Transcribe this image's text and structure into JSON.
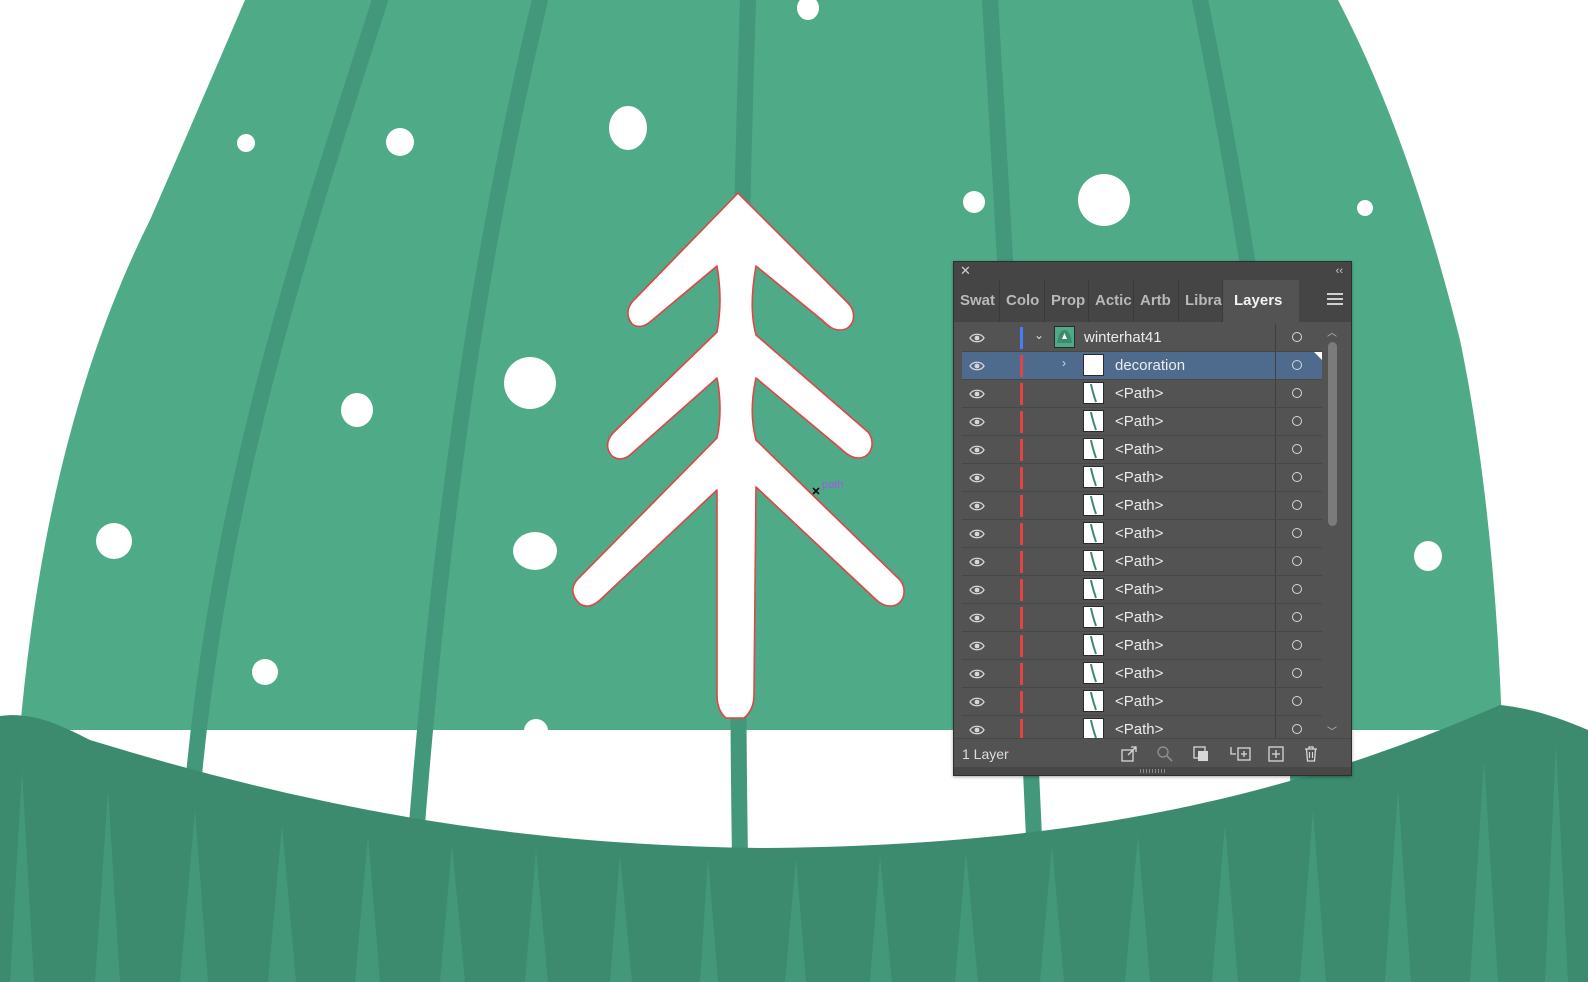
{
  "canvas": {
    "anchor_label": "path",
    "colors": {
      "hat_main": "#4faa88",
      "hat_stripes": "#43977a",
      "hat_cuff": "#3c8b6f",
      "cuff_ribs": "#44987a",
      "snow": "#ffffff",
      "tree_outline": "#e04040"
    }
  },
  "layers_panel": {
    "close_icon": "✕",
    "collapse_icon": "‹‹",
    "tabs": [
      {
        "label": "Swat"
      },
      {
        "label": "Colo"
      },
      {
        "label": "Prop"
      },
      {
        "label": "Actic"
      },
      {
        "label": "Artb"
      },
      {
        "label": "Libra"
      },
      {
        "label": "Layers",
        "active": true
      }
    ],
    "rows": [
      {
        "name": "winterhat41",
        "twisty": "⌄",
        "color": "#4a7bff",
        "thumb": "hat"
      },
      {
        "name": "decoration",
        "twisty": "›",
        "color": "#e04545",
        "thumb": "blank",
        "selected": true
      },
      {
        "name": "<Path>",
        "color": "#e04545",
        "thumb": "path"
      },
      {
        "name": "<Path>",
        "color": "#e04545",
        "thumb": "path"
      },
      {
        "name": "<Path>",
        "color": "#e04545",
        "thumb": "path"
      },
      {
        "name": "<Path>",
        "color": "#e04545",
        "thumb": "path"
      },
      {
        "name": "<Path>",
        "color": "#e04545",
        "thumb": "path"
      },
      {
        "name": "<Path>",
        "color": "#e04545",
        "thumb": "path"
      },
      {
        "name": "<Path>",
        "color": "#e04545",
        "thumb": "path"
      },
      {
        "name": "<Path>",
        "color": "#e04545",
        "thumb": "path"
      },
      {
        "name": "<Path>",
        "color": "#e04545",
        "thumb": "path"
      },
      {
        "name": "<Path>",
        "color": "#e04545",
        "thumb": "path"
      },
      {
        "name": "<Path>",
        "color": "#e04545",
        "thumb": "path"
      },
      {
        "name": "<Path>",
        "color": "#e04545",
        "thumb": "path"
      },
      {
        "name": "<Path>",
        "color": "#e04545",
        "thumb": "path"
      }
    ],
    "footer": {
      "layer_count": "1 Layer",
      "buttons": [
        "export-icon",
        "locate-object-icon",
        "clipping-mask-icon",
        "new-sublayer-icon",
        "new-layer-icon",
        "trash-icon"
      ]
    }
  }
}
